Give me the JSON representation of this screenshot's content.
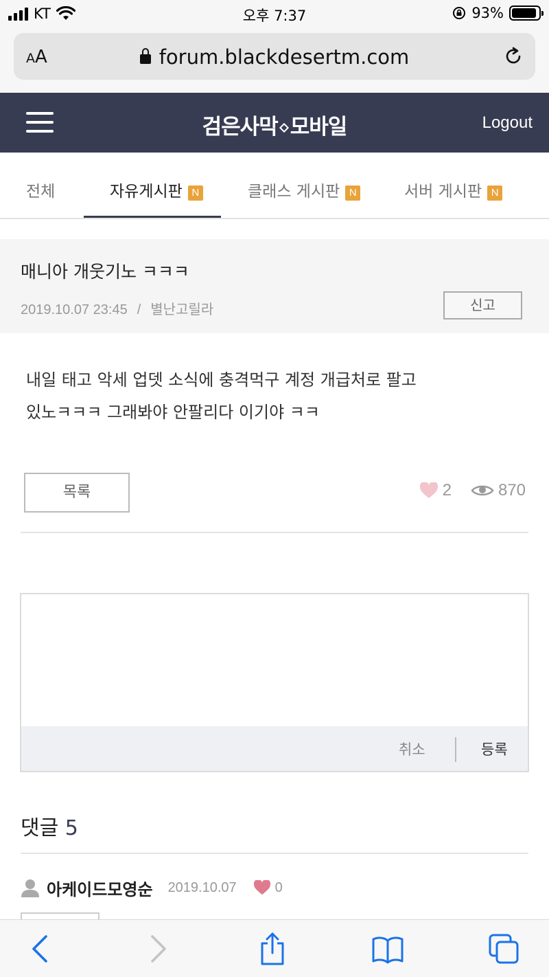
{
  "status_bar": {
    "carrier": "KT",
    "time": "오후 7:37",
    "battery": "93%",
    "battery_level": 0.93
  },
  "browser": {
    "text_size_label": "AA",
    "url": "forum.blackdesertm.com"
  },
  "site_header": {
    "logo_left": "검은사막",
    "logo_right": "모바일",
    "logout_label": "Logout"
  },
  "tabs": [
    {
      "label": "전체",
      "active": false,
      "badge": ""
    },
    {
      "label": "자유게시판",
      "active": true,
      "badge": "N"
    },
    {
      "label": "클래스 게시판",
      "active": false,
      "badge": "N"
    },
    {
      "label": "서버 게시판",
      "active": false,
      "badge": "N"
    }
  ],
  "post": {
    "title": "매니아 개웃기노 ㅋㅋㅋ",
    "date": "2019.10.07 23:45",
    "meta_separator": "/",
    "author": "별난고릴라",
    "report_label": "신고",
    "body_line1": "내일 태고 악세 업뎃 소식에 충격먹구 계정 개급처로 팔고",
    "body_line2": "있노ㅋㅋㅋ 그래봐야 안팔리다 이기야 ㅋㅋ",
    "list_label": "목록",
    "likes": "2",
    "views": "870"
  },
  "comment_box": {
    "placeholder": "",
    "cancel_label": "취소",
    "submit_label": "등록"
  },
  "comments": {
    "title_label": "댓글",
    "count": "5",
    "items": [
      {
        "author": "아케이드모영순",
        "date": "2019.10.07",
        "likes": "0"
      }
    ]
  },
  "colors": {
    "header_bg": "#373c52",
    "badge": "#e8a33a",
    "heart_light": "#f2c4cc",
    "heart_pink": "#e07a8e",
    "ios_blue": "#1a73e8"
  },
  "icons": [
    "wifi-icon",
    "lock-icon",
    "reload-icon",
    "hamburger-icon",
    "heart-icon",
    "eye-icon",
    "user-icon",
    "back-icon",
    "forward-icon",
    "share-icon",
    "bookmarks-icon",
    "tabs-icon"
  ]
}
